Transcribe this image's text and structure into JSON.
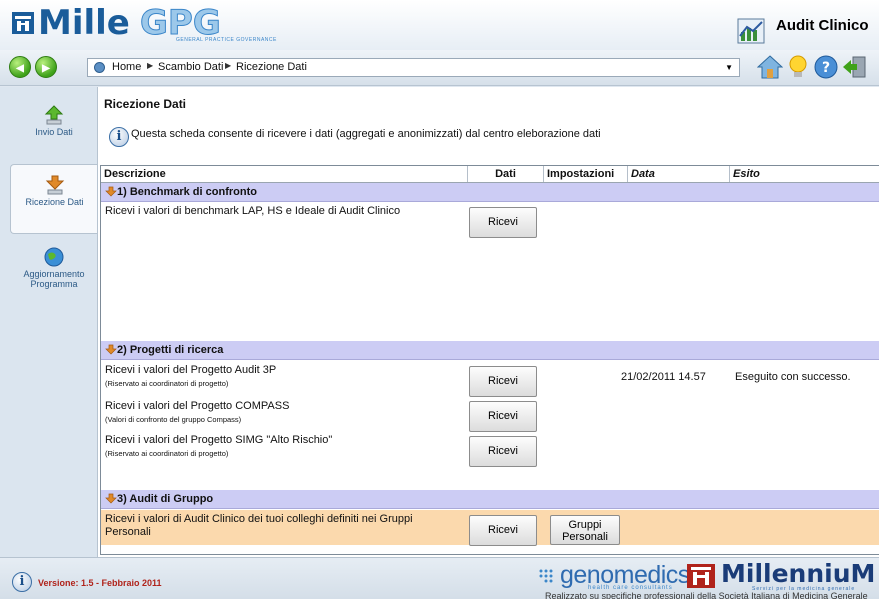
{
  "header": {
    "logo_main": "Mille",
    "logo_gpg": "GPG",
    "logo_sub": "GENERAL PRACTICE GOVERNANCE",
    "app_title": "Audit Clinico"
  },
  "navbar": {
    "back_glyph": "◀",
    "forward_glyph": "▶",
    "breadcrumb": [
      "Home",
      "Scambio Dati",
      "Ricezione Dati"
    ],
    "sep_glyph": "▶",
    "drop_glyph": "▼",
    "toolbar_icons": [
      "home-icon",
      "lightbulb-icon",
      "help-icon",
      "exit-icon"
    ]
  },
  "sidebar": {
    "items": [
      {
        "label": "Invio Dati",
        "icon": "upload-arrow-icon"
      },
      {
        "label": "Ricezione Dati",
        "icon": "download-arrow-icon"
      },
      {
        "label": "Aggiornamento Programma",
        "icon": "globe-update-icon"
      }
    ]
  },
  "main": {
    "title": "Ricezione Dati",
    "info_glyph": "i",
    "info_text": "Questa scheda consente di ricevere i dati (aggregati e anonimizzati) dal centro eleborazione dati",
    "columns": [
      "Descrizione",
      "Dati",
      "Impostazioni",
      "Data",
      "Esito"
    ],
    "sections": [
      {
        "title": "1) Benchmark di confronto",
        "rows": [
          {
            "text": "Ricevi i valori di benchmark LAP, HS e Ideale di Audit Clinico",
            "sub": "",
            "button": "Ricevi",
            "settings": "",
            "date": "",
            "result": ""
          }
        ]
      },
      {
        "title": "2) Progetti di ricerca",
        "rows": [
          {
            "text": "Ricevi i valori del Progetto Audit 3P",
            "sub": "(Riservato ai coordinatori di progetto)",
            "button": "Ricevi",
            "settings": "",
            "date": "21/02/2011 14.57",
            "result": "Eseguito con successo."
          },
          {
            "text": "Ricevi i valori del Progetto COMPASS",
            "sub": "(Valori di confronto del gruppo Compass)",
            "button": "Ricevi",
            "settings": "",
            "date": "",
            "result": ""
          },
          {
            "text": "Ricevi i valori del Progetto SIMG \"Alto Rischio\"",
            "sub": "(Riservato ai coordinatori di progetto)",
            "button": "Ricevi",
            "settings": "",
            "date": "",
            "result": ""
          }
        ]
      },
      {
        "title": "3) Audit di Gruppo",
        "rows": [
          {
            "text": "Ricevi i valori di Audit Clinico dei tuoi colleghi definiti nei Gruppi",
            "text2": "Personali",
            "button": "Ricevi",
            "settings_line1": "Gruppi",
            "settings_line2": "Personali",
            "date": "",
            "result": ""
          }
        ]
      }
    ]
  },
  "footer": {
    "info_glyph": "i",
    "version": "Versione: 1.5 - Febbraio 2011",
    "genomedics": "genomedics",
    "genomedics_sub": "health care consultants",
    "millennium": "MillenniuM",
    "millennium_sub": "Servizi per la medicina generale",
    "credits": "Realizzato su specifiche professionali della Società Italiana di Medicina Generale"
  },
  "colors": {
    "section_bg": "#ccccf4",
    "highlight_row": "#fbd9ad",
    "version_text": "#b0231b",
    "brand_blue": "#1a5c9a"
  }
}
